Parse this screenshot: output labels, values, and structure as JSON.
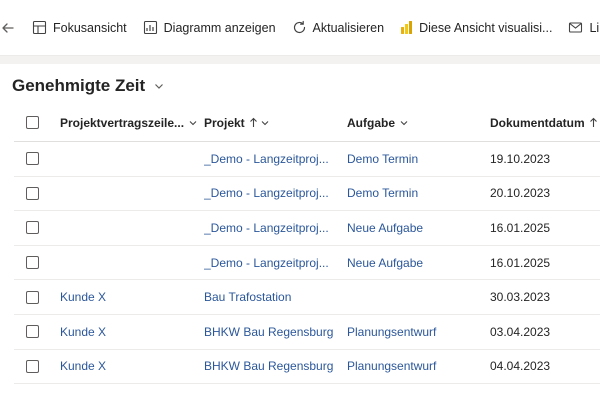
{
  "toolbar": {
    "focus_label": "Fokusansicht",
    "chart_label": "Diagramm anzeigen",
    "refresh_label": "Aktualisieren",
    "visualize_label": "Diese Ansicht visualisi...",
    "link_label": "Link"
  },
  "view": {
    "title": "Genehmigte Zeit"
  },
  "columns": {
    "contract_line": "Projektvertragszeile...",
    "project": "Projekt",
    "task": "Aufgabe",
    "doc_date": "Dokumentdatum"
  },
  "rows": [
    {
      "contract_line": "",
      "project": "_Demo - Langzeitproj...",
      "task": "Demo Termin",
      "doc_date": "19.10.2023"
    },
    {
      "contract_line": "",
      "project": "_Demo - Langzeitproj...",
      "task": "Demo Termin",
      "doc_date": "20.10.2023"
    },
    {
      "contract_line": "",
      "project": "_Demo - Langzeitproj...",
      "task": "Neue Aufgabe",
      "doc_date": "16.01.2025"
    },
    {
      "contract_line": "",
      "project": "_Demo - Langzeitproj...",
      "task": "Neue Aufgabe",
      "doc_date": "16.01.2025"
    },
    {
      "contract_line": "Kunde X",
      "project": "Bau Trafostation",
      "task": "",
      "doc_date": "30.03.2023"
    },
    {
      "contract_line": "Kunde X",
      "project": "BHKW Bau Regensburg",
      "task": "Planungsentwurf",
      "doc_date": "03.04.2023"
    },
    {
      "contract_line": "Kunde X",
      "project": "BHKW Bau Regensburg",
      "task": "Planungsentwurf",
      "doc_date": "04.04.2023"
    }
  ],
  "colors": {
    "link": "#2b579a",
    "accent_powerbi": "#f2c811"
  }
}
